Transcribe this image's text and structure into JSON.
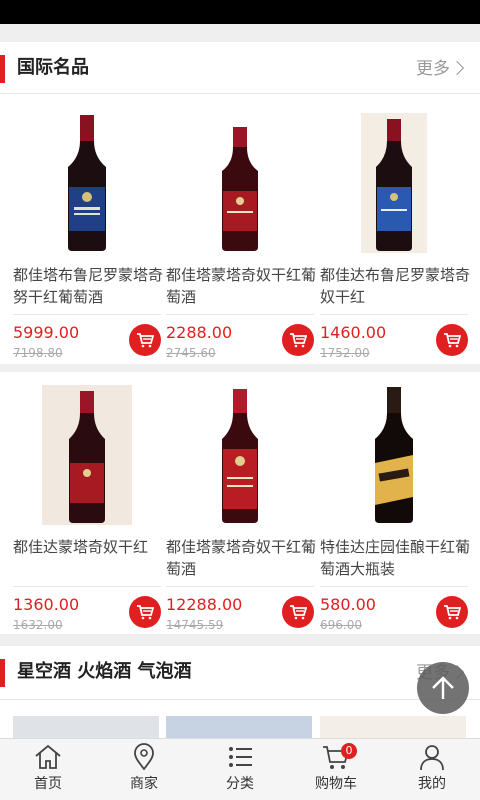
{
  "sections": [
    {
      "title": "国际名品",
      "more_label": "更多",
      "products": [
        {
          "name": "都佳塔布鲁尼罗蒙塔奇努干红葡萄酒",
          "price": "5999.00",
          "old_price": "7198.80"
        },
        {
          "name": "都佳塔蒙塔奇奴干红葡萄酒",
          "price": "2288.00",
          "old_price": "2745.60"
        },
        {
          "name": "都佳达布鲁尼罗蒙塔奇奴干红",
          "price": "1460.00",
          "old_price": "1752.00"
        },
        {
          "name": "都佳达蒙塔奇奴干红",
          "price": "1360.00",
          "old_price": "1632.00"
        },
        {
          "name": "都佳塔蒙塔奇奴干红葡萄酒",
          "price": "12288.00",
          "old_price": "14745.59"
        },
        {
          "name": "特佳达庄园佳酿干红葡萄酒大瓶装",
          "price": "580.00",
          "old_price": "696.00"
        }
      ]
    },
    {
      "title": "星空酒 火焰酒 气泡酒",
      "more_label": "更多"
    }
  ],
  "tabbar": [
    {
      "label": "首页",
      "icon": "home-icon"
    },
    {
      "label": "商家",
      "icon": "location-pin-icon"
    },
    {
      "label": "分类",
      "icon": "category-list-icon"
    },
    {
      "label": "购物车",
      "icon": "shopping-cart-icon",
      "badge": "0"
    },
    {
      "label": "我的",
      "icon": "user-icon"
    }
  ],
  "colors": {
    "accent": "#e02020",
    "background": "#efefef"
  }
}
